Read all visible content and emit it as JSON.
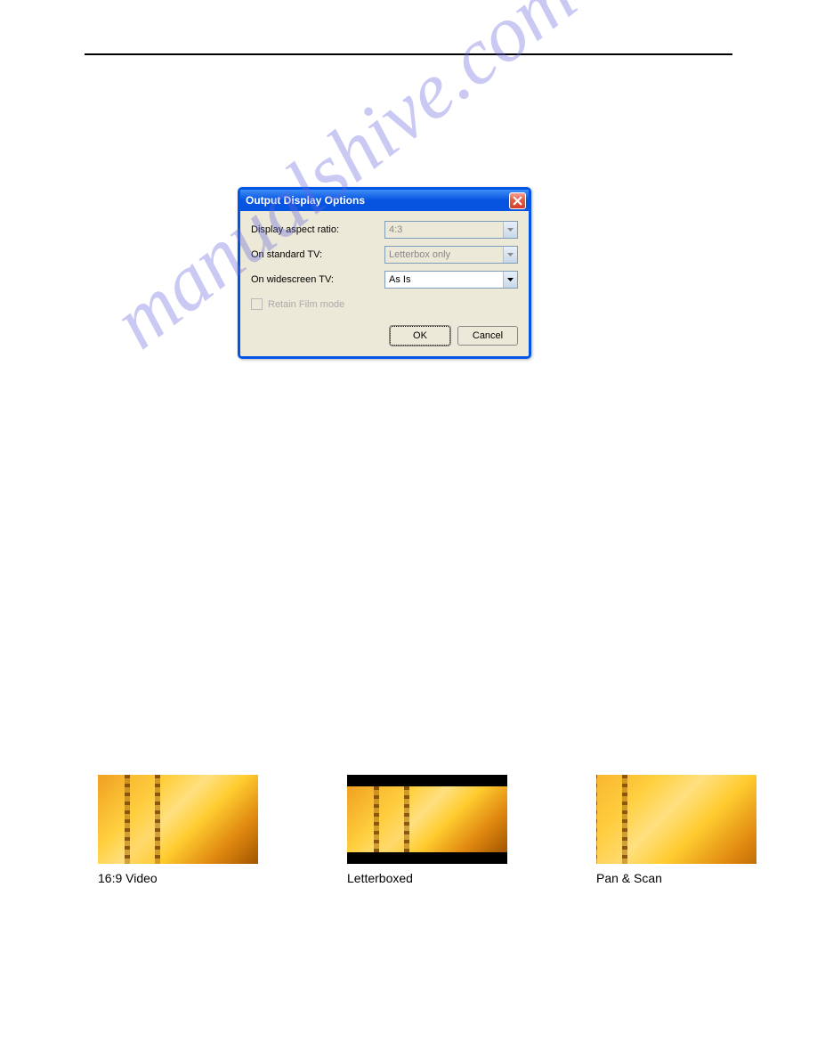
{
  "watermark": "manualshive.com",
  "dialog": {
    "title": "Output Display Options",
    "fields": {
      "aspect_ratio": {
        "label": "Display aspect ratio:",
        "value": "4:3"
      },
      "standard_tv": {
        "label": "On standard TV:",
        "value": "Letterbox only"
      },
      "widescreen_tv": {
        "label": "On widescreen TV:",
        "value": "As Is"
      }
    },
    "checkbox": {
      "label": "Retain Film mode"
    },
    "buttons": {
      "ok": "OK",
      "cancel": "Cancel"
    }
  },
  "images": {
    "item1": "16:9 Video",
    "item2": "Letterboxed",
    "item3": "Pan & Scan"
  }
}
